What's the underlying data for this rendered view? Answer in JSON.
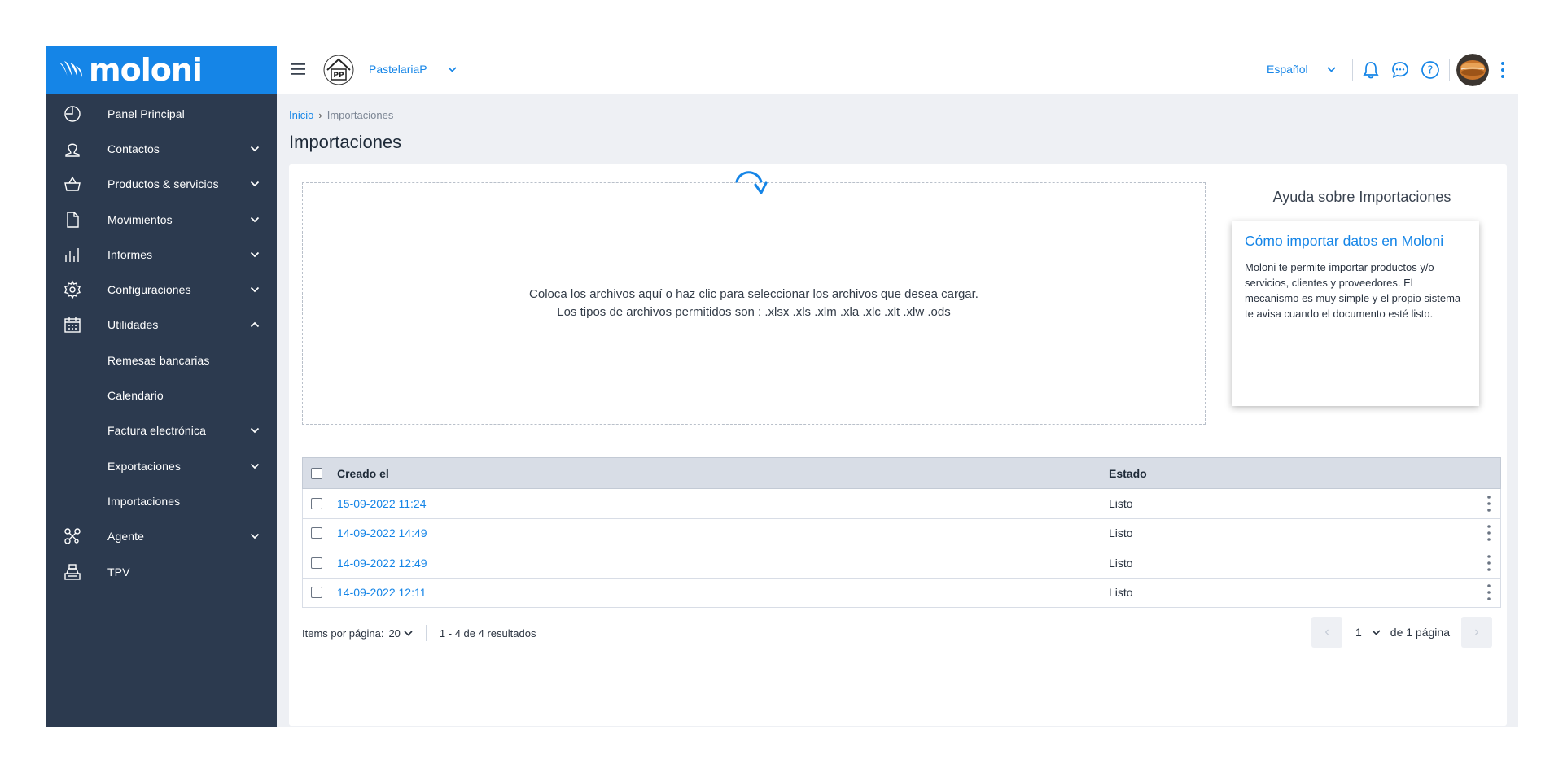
{
  "brand": {
    "logo_text": "moloni",
    "color": "#1585e7"
  },
  "sidebar": {
    "items": [
      {
        "label": "Panel Principal",
        "icon": "dashboard-icon",
        "chevron": ""
      },
      {
        "label": "Contactos",
        "icon": "contacts-icon",
        "chevron": "down"
      },
      {
        "label": "Productos & servicios",
        "icon": "basket-icon",
        "chevron": "down"
      },
      {
        "label": "Movimientos",
        "icon": "document-icon",
        "chevron": "down"
      },
      {
        "label": "Informes",
        "icon": "chart-bars-icon",
        "chevron": "down"
      },
      {
        "label": "Configuraciones",
        "icon": "gear-icon",
        "chevron": "down"
      },
      {
        "label": "Utilidades",
        "icon": "calendar-icon",
        "chevron": "up"
      },
      {
        "label": "Remesas bancarias",
        "icon": "",
        "chevron": ""
      },
      {
        "label": "Calendario",
        "icon": "",
        "chevron": ""
      },
      {
        "label": "Factura electrónica",
        "icon": "",
        "chevron": "down"
      },
      {
        "label": "Exportaciones",
        "icon": "",
        "chevron": "down"
      },
      {
        "label": "Importaciones",
        "icon": "",
        "chevron": ""
      },
      {
        "label": "Agente",
        "icon": "network-icon",
        "chevron": "down"
      },
      {
        "label": "TPV",
        "icon": "cash-register-icon",
        "chevron": ""
      }
    ]
  },
  "header": {
    "company_name": "PastelariaP",
    "language": "Español",
    "icons": [
      "bell-icon",
      "chat-icon",
      "help-icon"
    ]
  },
  "breadcrumb": {
    "home": "Inicio",
    "separator": "›",
    "current": "Importaciones"
  },
  "page_title": "Importaciones",
  "dropzone": {
    "line1": "Coloca los archivos aquí o haz clic para seleccionar los archivos que desea cargar.",
    "line2": "Los tipos de archivos permitidos son : .xlsx .xls .xlm .xla .xlc .xlt .xlw .ods"
  },
  "help": {
    "title": "Ayuda sobre Importaciones",
    "card_title": "Cómo importar datos en Moloni",
    "card_body": "Moloni te permite importar productos y/o servicios, clientes y proveedores. El mecanismo es muy simple y el propio sistema te avisa cuando el documento esté listo."
  },
  "table": {
    "columns": {
      "created": "Creado el",
      "state": "Estado"
    },
    "rows": [
      {
        "created": "15-09-2022 11:24",
        "state": "Listo"
      },
      {
        "created": "14-09-2022 14:49",
        "state": "Listo"
      },
      {
        "created": "14-09-2022 12:49",
        "state": "Listo"
      },
      {
        "created": "14-09-2022 12:11",
        "state": "Listo"
      }
    ]
  },
  "pagination": {
    "per_page_label": "Items por página:",
    "per_page_value": "20",
    "results": "1 - 4 de 4 resultados",
    "prev": "‹",
    "page": "1",
    "total_label": "de 1 página",
    "next": "›"
  }
}
